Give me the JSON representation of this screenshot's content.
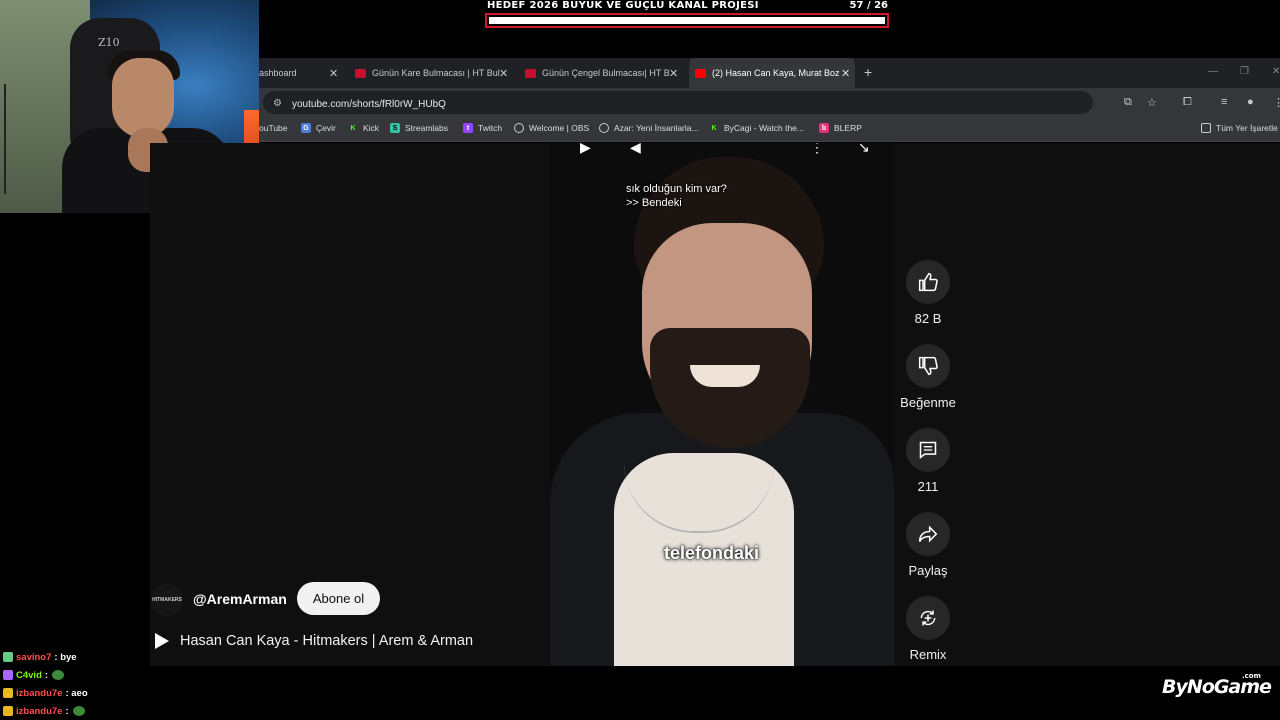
{
  "goal": {
    "title": "HEDEF 2026 BÜYÜK VE GÜÇLÜ KANAL PROJESİ",
    "count": "57  / 26",
    "progress": 1.0
  },
  "webcam": {
    "chair_logo": "Z10"
  },
  "browser": {
    "tabs": [
      {
        "label": "ashboard",
        "active": false
      },
      {
        "label": "Günün Kare Bulmacası | HT Bul",
        "active": false
      },
      {
        "label": "Günün Çengel Bulmacası| HT B",
        "active": false
      },
      {
        "label": "(2) Hasan Can Kaya, Murat Boz",
        "active": true
      }
    ],
    "new_tab": "+",
    "url": "youtube.com/shorts/fRl0rW_HUbQ",
    "bookmarks": [
      {
        "label": "ouTube",
        "icon": "youtube-icon",
        "color": "#ff0000"
      },
      {
        "label": "Çevir",
        "icon": "translate-icon",
        "color": "#4a7fe0"
      },
      {
        "label": "Kick",
        "icon": "kick-icon",
        "color": "#53fc18"
      },
      {
        "label": "Streamlabs",
        "icon": "streamlabs-icon",
        "color": "#31c3a2"
      },
      {
        "label": "Twitch",
        "icon": "twitch-icon",
        "color": "#9146ff"
      },
      {
        "label": "Welcome | OBS",
        "icon": "obs-icon",
        "color": "#dddddd"
      },
      {
        "label": "Azar: Yeni İnsanlarla...",
        "icon": "azar-icon",
        "color": "#dddddd"
      },
      {
        "label": "ByCagi - Watch the...",
        "icon": "kick-icon",
        "color": "#53fc18"
      },
      {
        "label": "BLERP",
        "icon": "blerp-icon",
        "color": "#e0337a"
      }
    ],
    "all_bookmarks": "Tüm Yer İşaretle"
  },
  "video": {
    "quote_line1": "sık olduğun kim var?",
    "quote_line2": ">> Bendeki",
    "caption": "telefondaki"
  },
  "actions": {
    "like": "82 B",
    "dislike": "Beğenme",
    "comments": "211",
    "share": "Paylaş",
    "remix": "Remix"
  },
  "channel": {
    "avatar_text": "HITMAKERS",
    "handle": "@AremArman",
    "subscribe": "Abone ol"
  },
  "video_title": "Hasan Can Kaya - Hitmakers | Arem & Arman",
  "chat": [
    {
      "user": "savino7",
      "msg": ": bye",
      "color": "#ff4d4d",
      "emote": false
    },
    {
      "user": "C4vid",
      "msg": ":",
      "color": "#7cfc00",
      "emote": true
    },
    {
      "user": "izbandu7e",
      "msg": ": aeo",
      "color": "#ff4d4d",
      "emote": false
    },
    {
      "user": "izbandu7e",
      "msg": ":",
      "color": "#ff4d4d",
      "emote": true
    }
  ],
  "logo": {
    "text": "ByNoGame",
    "suffix": ".com"
  }
}
